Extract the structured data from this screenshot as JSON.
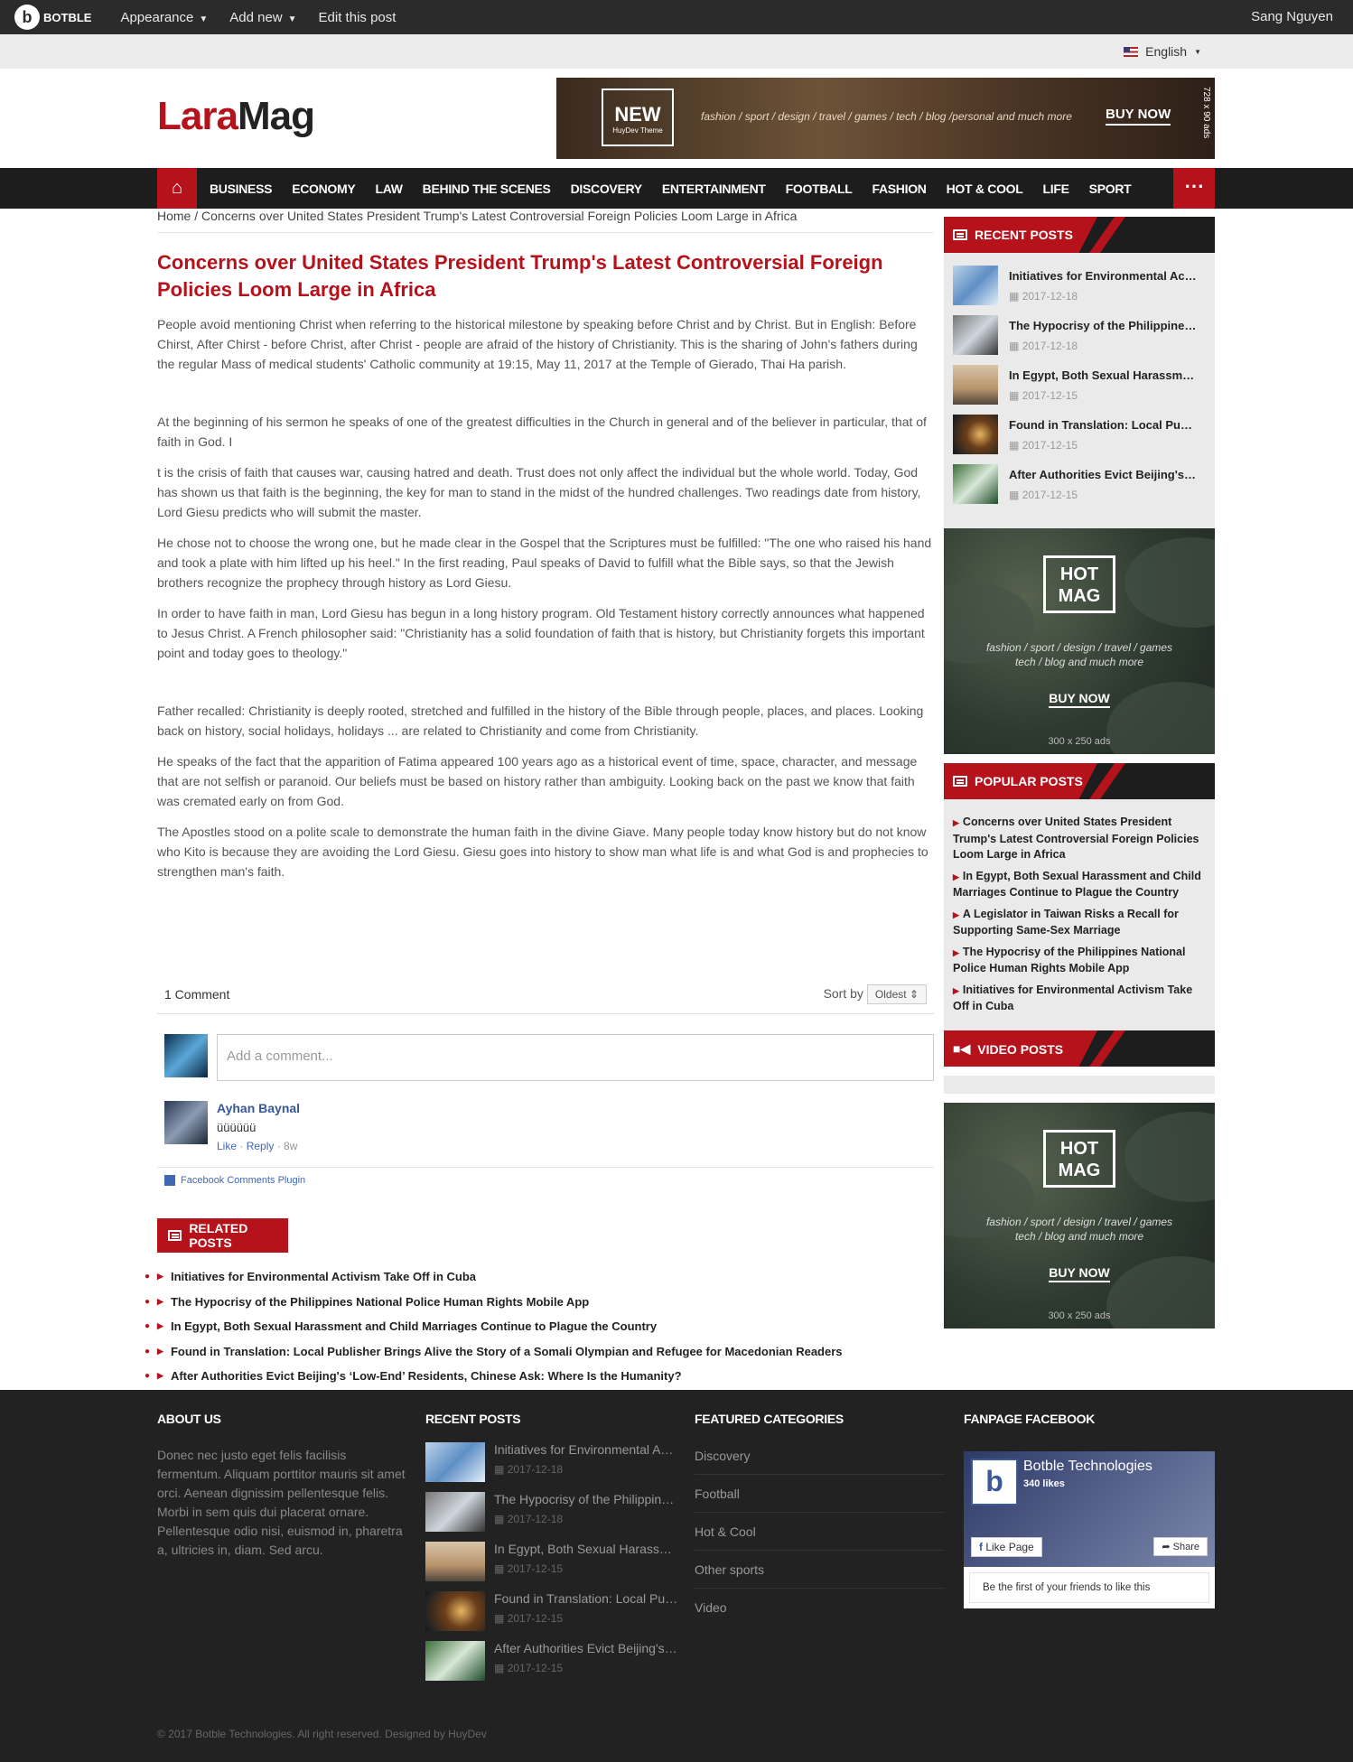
{
  "admin_bar": {
    "logo_text": "BOTBLE",
    "items": [
      "Appearance",
      "Add new",
      "Edit this post"
    ],
    "user": "Sang Nguyen"
  },
  "top_bar": {
    "language": "English"
  },
  "brand": {
    "part1": "Lara",
    "part2": "Mag"
  },
  "top_banner": {
    "box_title": "NEW",
    "box_sub": "HuyDev Theme",
    "tagline": "fashion / sport / design / travel / games / tech / blog /personal and much more",
    "cta": "BUY NOW",
    "dims": "728 x 90 ads"
  },
  "nav": {
    "items": [
      "BUSINESS",
      "ECONOMY",
      "LAW",
      "BEHIND THE SCENES",
      "DISCOVERY",
      "ENTERTAINMENT",
      "FOOTBALL",
      "FASHION",
      "HOT & COOL",
      "LIFE",
      "SPORT"
    ],
    "more": "⋯"
  },
  "breadcrumb": "Home / Concerns over United States President Trump's Latest Controversial Foreign Policies Loom Large in Africa",
  "article": {
    "title": "Concerns over United States President Trump's Latest Controversial Foreign Policies Loom Large in Africa",
    "paragraphs": [
      "People avoid mentioning Christ when referring to the historical milestone by speaking before Christ and by Christ. But in English: Before Chirst, After Chirst - before Christ, after Christ - people are afraid of the history of Christianity. This is the sharing of John's fathers during the regular Mass of medical students' Catholic community at 19:15, May 11, 2017 at the Temple of Gierado, Thai Ha parish.",
      "At the beginning of his sermon he speaks of one of the greatest difficulties in the Church in general and of the believer in particular, that of faith in God. I",
      "t is the crisis of faith that causes war, causing hatred and death. Trust does not only affect the individual but the whole world. Today, God has shown us that faith is the beginning, the key for man to stand in the midst of the hundred challenges. Two readings date from history, Lord Giesu predicts who will submit the master.",
      "He chose not to choose the wrong one, but he made clear in the Gospel that the Scriptures must be fulfilled: \"The one who raised his hand and took a plate with him lifted up his heel.\" In the first reading, Paul speaks of David to fulfill what the Bible says, so that the Jewish brothers recognize the prophecy through history as Lord Giesu.",
      "In order to have faith in man, Lord Giesu has begun in a long history program. Old Testament history correctly announces what happened to Jesus Christ. A French philosopher said: \"Christianity has a solid foundation of faith that is history, but Christianity forgets this important point and today goes to theology.\"",
      "Father recalled: Christianity is deeply rooted, stretched and fulfilled in the history of the Bible through people, places, and places. Looking back on history, social holidays, holidays ... are related to Christianity and come from Christianity.",
      "He speaks of the fact that the apparition of Fatima appeared 100 years ago as a historical event of time, space, character, and message that are not selfish or paranoid. Our beliefs must be based on history rather than ambiguity. Looking back on the past we know that faith was cremated early on from God.",
      "The Apostles stood on a polite scale to demonstrate the human faith in the divine Giave. Many people today know history but do not know who Kito is because they are avoiding the Lord Giesu. Giesu goes into history to show man what life is and what God is and prophecies to strengthen man's faith."
    ]
  },
  "comments": {
    "count_label": "1 Comment",
    "sort_label": "Sort by",
    "sort_value": "Oldest",
    "placeholder": "Add a comment...",
    "item": {
      "name": "Ayhan Baynal",
      "text": "üüüüüü",
      "like": "Like",
      "reply": "Reply",
      "age": "8w"
    },
    "plugin": "Facebook Comments Plugin"
  },
  "related": {
    "heading": "RELATED POSTS",
    "items": [
      "Initiatives for Environmental Activism Take Off in Cuba",
      "The Hypocrisy of the Philippines National Police Human Rights Mobile App",
      "In Egypt, Both Sexual Harassment and Child Marriages Continue to Plague the Country",
      "Found in Translation: Local Publisher Brings Alive the Story of a Somali Olympian and Refugee for Macedonian Readers",
      "After Authorities Evict Beijing's ‘Low-End’ Residents, Chinese Ask: Where Is the Humanity?"
    ]
  },
  "sidebar": {
    "recent_heading": "RECENT POSTS",
    "recent": [
      {
        "title": "Initiatives for Environmental Activism Take Off in Cuba",
        "date": "2017-12-18"
      },
      {
        "title": "The Hypocrisy of the Philippines National Police",
        "date": "2017-12-18"
      },
      {
        "title": "In Egypt, Both Sexual Harassment and Child",
        "date": "2017-12-15"
      },
      {
        "title": "Found in Translation: Local Publisher Brings",
        "date": "2017-12-15"
      },
      {
        "title": "After Authorities Evict Beijing's ‘Low-End’",
        "date": "2017-12-15"
      }
    ],
    "ad": {
      "logo_l1": "HOT",
      "logo_l2": "MAG",
      "tagline_l1": "fashion / sport / design / travel / games",
      "tagline_l2": "tech / blog and much more",
      "cta": "BUY NOW",
      "dims": "300 x 250 ads"
    },
    "popular_heading": "POPULAR POSTS",
    "popular": [
      "Concerns over United States President Trump's Latest Controversial Foreign Policies Loom Large in Africa",
      "In Egypt, Both Sexual Harassment and Child Marriages Continue to Plague the Country",
      "A Legislator in Taiwan Risks a Recall for Supporting Same-Sex Marriage",
      "The Hypocrisy of the Philippines National Police Human Rights Mobile App",
      "Initiatives for Environmental Activism Take Off in Cuba"
    ],
    "video_heading": "VIDEO POSTS"
  },
  "footer": {
    "about_heading": "ABOUT US",
    "about_text": "Donec nec justo eget felis facilisis fermentum. Aliquam porttitor mauris sit amet orci. Aenean dignissim pellentesque felis. Morbi in sem quis dui placerat ornare. Pellentesque odio nisi, euismod in, pharetra a, ultricies in, diam. Sed arcu.",
    "recent_heading": "RECENT POSTS",
    "recent": [
      {
        "title": "Initiatives for Environmental Activism Take Off in Cuba",
        "date": "2017-12-18"
      },
      {
        "title": "The Hypocrisy of the Philippines National Police",
        "date": "2017-12-18"
      },
      {
        "title": "In Egypt, Both Sexual Harassment and Child Marriages",
        "date": "2017-12-15"
      },
      {
        "title": "Found in Translation: Local Publisher Brings Alive",
        "date": "2017-12-15"
      },
      {
        "title": "After Authorities Evict Beijing's ‘Low-End’ Residents",
        "date": "2017-12-15"
      }
    ],
    "categories_heading": "FEATURED CATEGORIES",
    "categories": [
      "Discovery",
      "Football",
      "Hot & Cool",
      "Other sports",
      "Video"
    ],
    "fanpage_heading": "FANPAGE FACEBOOK",
    "fanpage": {
      "name": "Botble Technologies",
      "likes": "340 likes",
      "like_btn": "Like Page",
      "share_btn": "Share",
      "friends": "Be the first of your friends to like this"
    },
    "copyright": "© 2017 Botble Technologies. All right reserved. Designed by HuyDev"
  }
}
